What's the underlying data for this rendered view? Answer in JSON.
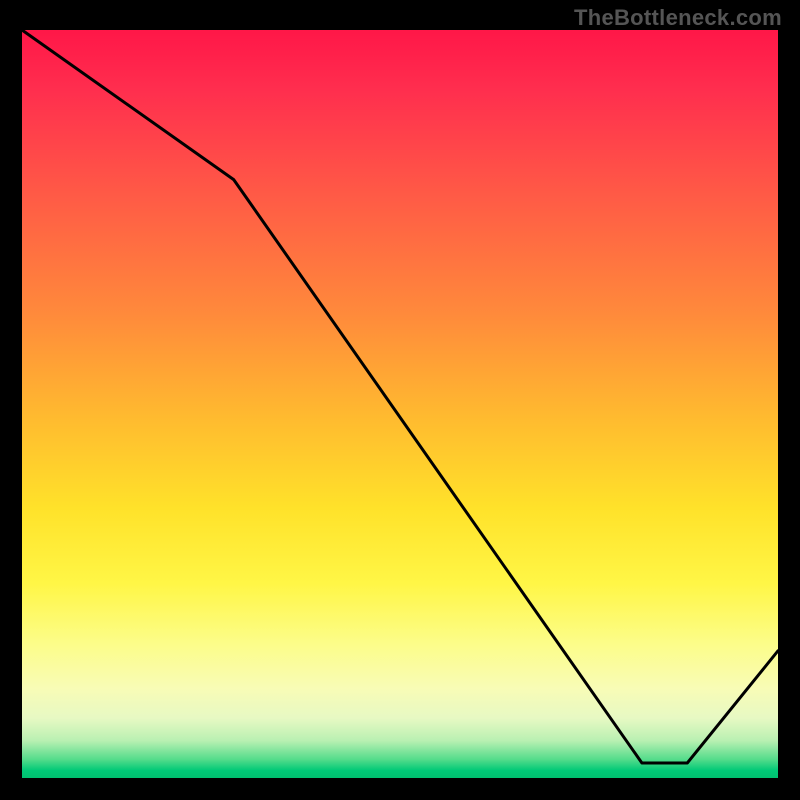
{
  "watermark": "TheBottleneck.com",
  "chart_data": {
    "type": "line",
    "title": "",
    "xlabel": "",
    "ylabel": "",
    "xlim": [
      0,
      100
    ],
    "ylim": [
      0,
      100
    ],
    "x": [
      0,
      28,
      82,
      88,
      100
    ],
    "values": [
      100,
      80,
      2,
      2,
      17
    ],
    "annotation": {
      "text": "",
      "x": 85,
      "y": 3
    },
    "gradient_stops": [
      {
        "pct": 0,
        "color": "#ff1748"
      },
      {
        "pct": 50,
        "color": "#ffbb2f"
      },
      {
        "pct": 80,
        "color": "#fcfd89"
      },
      {
        "pct": 100,
        "color": "#00c070"
      }
    ]
  },
  "colors": {
    "line": "#000000",
    "label": "#e03a2a",
    "watermark": "#555555"
  }
}
